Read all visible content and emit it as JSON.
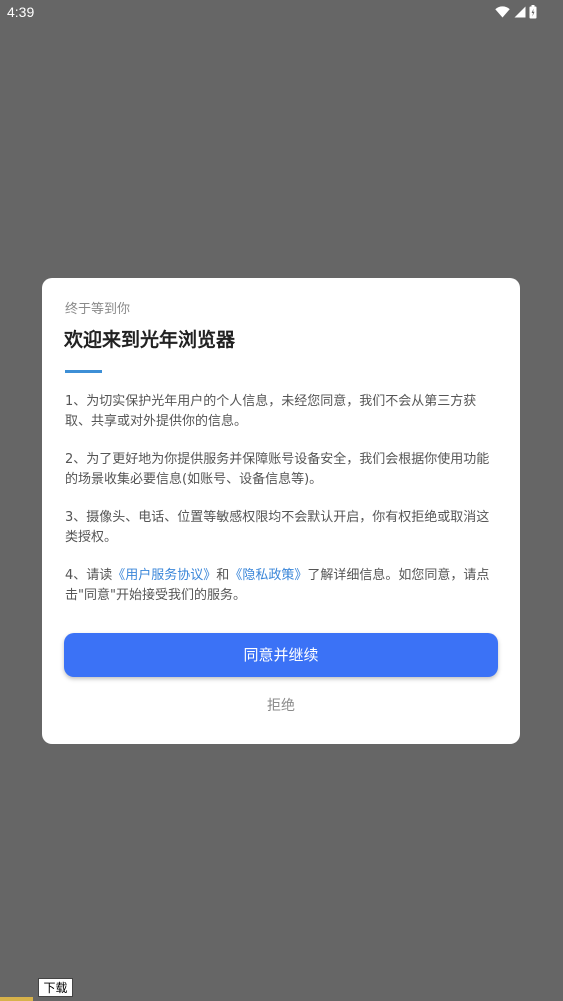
{
  "status_bar": {
    "time": "4:39",
    "icons": [
      "wifi-icon",
      "signal-icon",
      "battery-icon"
    ]
  },
  "dialog": {
    "subtitle": "终于等到你",
    "title": "欢迎来到光年浏览器",
    "terms": [
      "1、为切实保护光年用户的个人信息，未经您同意，我们不会从第三方获取、共享或对外提供你的信息。",
      "2、为了更好地为你提供服务并保障账号设备安全，我们会根据你使用功能的场景收集必要信息(如账号、设备信息等)。",
      "3、摄像头、电话、位置等敏感权限均不会默认开启，你有权拒绝或取消这类授权。"
    ],
    "term4": {
      "prefix": "4、请读",
      "user_agreement_link": "《用户服务协议》",
      "and": "和",
      "privacy_policy_link": "《隐私政策》",
      "suffix": "了解详细信息。如您同意，请点击\"同意\"开始接受我们的服务。"
    },
    "agree_button": "同意并继续",
    "reject_button": "拒绝"
  },
  "download_tooltip": "下载",
  "colors": {
    "overlay": "#666666",
    "accent_button": "#3b72f6",
    "link": "#3a86d9",
    "underline": "#3d8fd6"
  }
}
